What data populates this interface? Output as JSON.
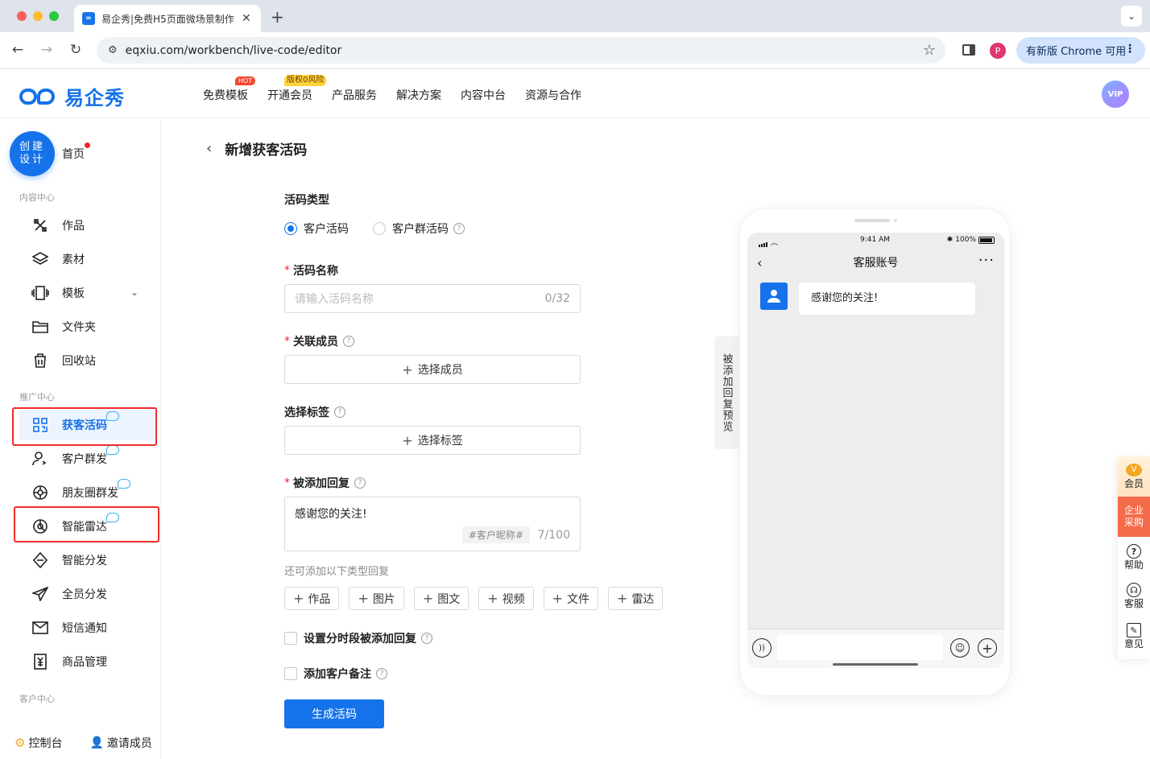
{
  "browser": {
    "tab_title": "易企秀|免费H5页面微场景制作",
    "tab_favicon": "∞",
    "url": "eqxiu.com/workbench/live-code/editor",
    "profile_initial": "P",
    "update_label": "有新版 Chrome 可用"
  },
  "header": {
    "logo_text": "易企秀",
    "nav": [
      {
        "label": "免费模板",
        "badge": "HOT"
      },
      {
        "label": "开通会员",
        "badge": "版权0风险"
      },
      {
        "label": "产品服务"
      },
      {
        "label": "解决方案"
      },
      {
        "label": "内容中台"
      },
      {
        "label": "资源与合作"
      }
    ],
    "vip_label": "VIP"
  },
  "sidebar": {
    "create_line1": "创建",
    "create_line2": "设计",
    "home": "首页",
    "sections": {
      "content": "内容中心",
      "promo": "推广中心",
      "customer": "客户中心"
    },
    "content_items": [
      "作品",
      "素材",
      "模板",
      "文件夹",
      "回收站"
    ],
    "promo_items": [
      "获客活码",
      "客户群发",
      "朋友圈群发",
      "智能雷达",
      "智能分发",
      "全员分发",
      "短信通知",
      "商品管理"
    ],
    "footer": {
      "console": "控制台",
      "invite": "邀请成员"
    }
  },
  "main": {
    "page_title": "新增获客活码",
    "type_label": "活码类型",
    "type_options": [
      "客户活码",
      "客户群活码"
    ],
    "type_selected": "客户活码",
    "name_label": "活码名称",
    "name_placeholder": "请输入活码名称",
    "name_count": "0/32",
    "member_label": "关联成员",
    "member_button": "选择成员",
    "tag_label": "选择标签",
    "tag_button": "选择标签",
    "reply_label": "被添加回复",
    "reply_text": "感谢您的关注!",
    "reply_tag": "#客户昵称#",
    "reply_count": "7/100",
    "more_hint": "还可添加以下类型回复",
    "reply_types": [
      "作品",
      "图片",
      "图文",
      "视频",
      "文件",
      "雷达"
    ],
    "option_schedule": "设置分时段被添加回复",
    "option_remark": "添加客户备注",
    "submit": "生成活码"
  },
  "preview": {
    "tab_text": "被添加回复预览",
    "time": "9:41 AM",
    "battery": "100%",
    "chat_title": "客服账号",
    "bubble_text": "感谢您的关注!"
  },
  "floatbar": {
    "vip": "会员",
    "biz_line1": "企业",
    "biz_line2": "采购",
    "help": "帮助",
    "service": "客服",
    "feedback": "意见"
  },
  "colors": {
    "accent": "#1572ea",
    "required": "#f5222d",
    "highlight": "#ef2b2b"
  }
}
